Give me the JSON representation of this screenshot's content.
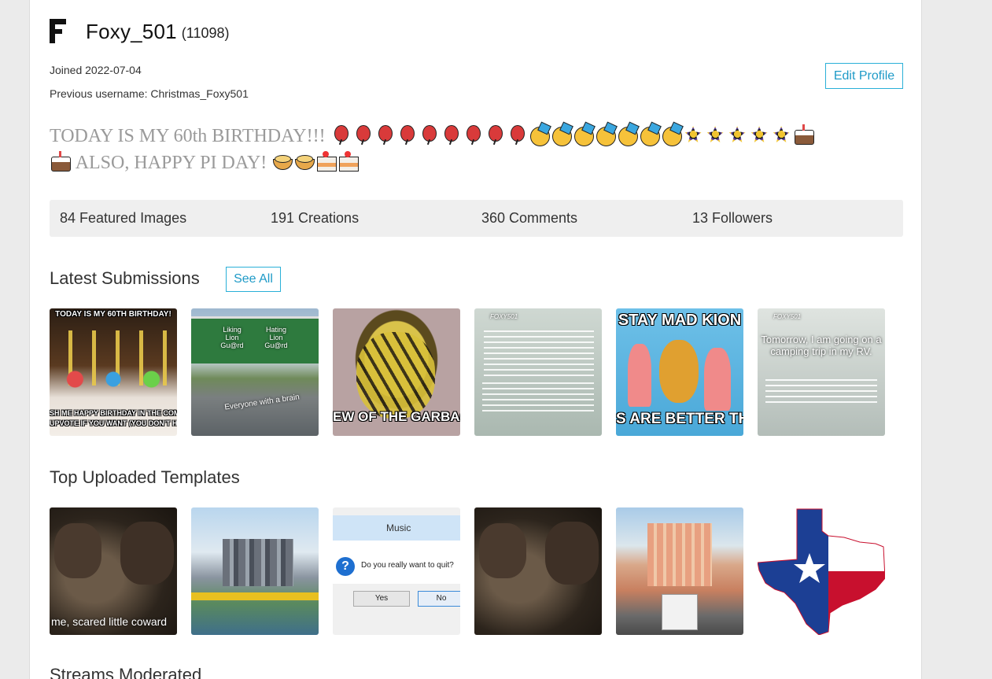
{
  "profile": {
    "username": "Foxy_501",
    "points": "(11098)",
    "joined": "Joined 2022-07-04",
    "previous_username": "Previous username: Christmas_Foxy501",
    "edit_label": "Edit Profile"
  },
  "bio": {
    "line1_text": "TODAY IS MY 60th BIRTHDAY!!!",
    "line2_text": "ALSO, HAPPY PI DAY!",
    "line1_emojis": [
      "balloon",
      "balloon",
      "balloon",
      "balloon",
      "balloon",
      "balloon",
      "balloon",
      "balloon",
      "balloon",
      "party",
      "party",
      "party",
      "party",
      "party",
      "party",
      "party",
      "firework",
      "firework",
      "firework",
      "firework",
      "firework",
      "cake"
    ],
    "line2_lead_emojis": [
      "cake"
    ],
    "line2_emojis": [
      "pie",
      "pie",
      "slice",
      "slice"
    ]
  },
  "stats": [
    {
      "label": "84 Featured Images"
    },
    {
      "label": "191 Creations"
    },
    {
      "label": "360 Comments"
    },
    {
      "label": "13 Followers"
    }
  ],
  "sections": {
    "latest_title": "Latest Submissions",
    "see_all": "See All",
    "templates_title": "Top Uploaded Templates",
    "streams_title": "Streams Moderated"
  },
  "latest": [
    {
      "top": "TODAY IS MY 60TH BIRTHDAY!",
      "bottom1": "SH ME HAPPY BIRTHDAY IN THE COMM",
      "bottom2": "UPVOTE IF YOU WANT (YOU DON'T HAV"
    },
    {
      "sign_left": "Liking Lion Gu@rd",
      "sign_right": "Hating Lion Gu@rd",
      "bottom": "Everyone with a brain"
    },
    {
      "bottom": "EW OF THE GARBAGE"
    },
    {
      "tag": "FOXY501"
    },
    {
      "top": "STAY MAD KION",
      "bottom": "S ARE BETTER THA"
    },
    {
      "tag": "FOXY501",
      "text1": "Tomorrow, I am going on a camping trip in my RV."
    }
  ],
  "templates": [
    {
      "bottom": "me, scared little coward"
    },
    {},
    {
      "title": "Music",
      "question": "Do you really want to quit?",
      "yes": "Yes",
      "no": "No"
    },
    {},
    {},
    {}
  ]
}
